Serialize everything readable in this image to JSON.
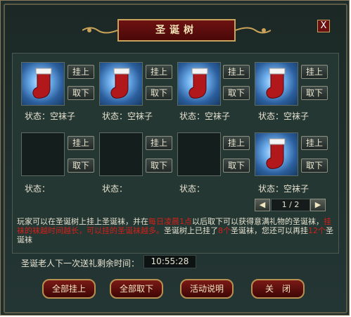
{
  "window": {
    "title": "圣诞树",
    "close_label": "X"
  },
  "slot_buttons": {
    "hang_label": "挂上",
    "remove_label": "取下"
  },
  "slots": [
    {
      "status": "状态：空袜子",
      "has_sock": true
    },
    {
      "status": "状态：空袜子",
      "has_sock": true
    },
    {
      "status": "状态：空袜子",
      "has_sock": true
    },
    {
      "status": "状态：空袜子",
      "has_sock": true
    },
    {
      "status": "状态：",
      "has_sock": false
    },
    {
      "status": "状态：",
      "has_sock": false
    },
    {
      "status": "状态：",
      "has_sock": false
    },
    {
      "status": "状态：空袜子",
      "has_sock": true
    }
  ],
  "pager": {
    "prev_label": "◀",
    "text": "1 / 2",
    "next_label": "▶"
  },
  "description": {
    "p1": "玩家可以在圣诞树上挂上圣诞袜，并在",
    "p2": "每日凌晨1点",
    "p3": "以后取下可以获得意满礼物的圣诞袜，",
    "p4": "挂袜的袜越时间越长，可以挂的圣诞袜越多。",
    "p5": "圣诞树上已挂了",
    "p6": "8个",
    "p7": "圣诞袜，您还可以再挂",
    "p8": "12个",
    "p9": "圣诞袜"
  },
  "timer": {
    "label": "圣诞老人下一次送礼剩余时间：",
    "value": "10:55:28"
  },
  "bottom_buttons": {
    "hang_all": "全部挂上",
    "remove_all": "全部取下",
    "event_info": "活动说明",
    "close": "关　闭"
  },
  "colors": {
    "accent_red": "#d0201a",
    "button_red": "#6e1212",
    "gold_border": "#c9a35a"
  },
  "icons": {
    "sock": "christmas-stocking-icon",
    "close": "close-icon"
  }
}
